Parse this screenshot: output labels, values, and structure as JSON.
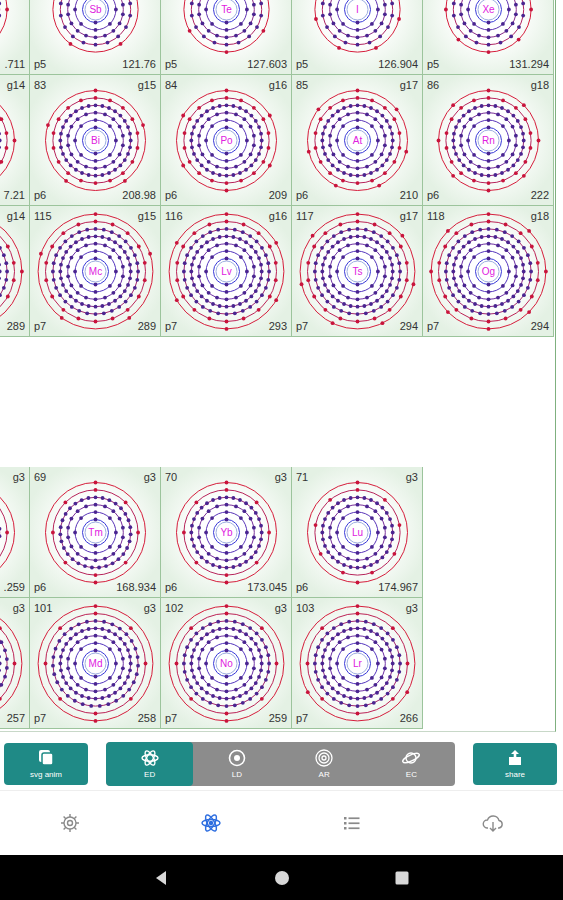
{
  "table": {
    "rows": [
      {
        "cells": [
          {
            "kind": "corner",
            "mass": ".711",
            "shells": [
              2,
              8,
              18,
              18,
              4
            ]
          },
          {
            "kind": "top",
            "symbol": "Sb",
            "period": "p5",
            "mass": "121.76",
            "shells": [
              2,
              8,
              18,
              18,
              5
            ]
          },
          {
            "kind": "top",
            "symbol": "Te",
            "period": "p5",
            "mass": "127.603",
            "shells": [
              2,
              8,
              18,
              18,
              6
            ]
          },
          {
            "kind": "top",
            "symbol": "I",
            "period": "p5",
            "mass": "126.904",
            "shells": [
              2,
              8,
              18,
              18,
              7
            ]
          },
          {
            "kind": "top",
            "symbol": "Xe",
            "period": "p5",
            "mass": "131.294",
            "shells": [
              2,
              8,
              18,
              18,
              8
            ]
          }
        ]
      },
      {
        "cells": [
          {
            "kind": "left",
            "group": "g14",
            "mass": "7.21",
            "shells": [
              2,
              8,
              18,
              32,
              18,
              4
            ]
          },
          {
            "kind": "full",
            "number": "83",
            "group": "g15",
            "symbol": "Bi",
            "period": "p6",
            "mass": "208.98",
            "shells": [
              2,
              8,
              18,
              32,
              18,
              5
            ]
          },
          {
            "kind": "full",
            "number": "84",
            "group": "g16",
            "symbol": "Po",
            "period": "p6",
            "mass": "209",
            "shells": [
              2,
              8,
              18,
              32,
              18,
              6
            ]
          },
          {
            "kind": "full",
            "number": "85",
            "group": "g17",
            "symbol": "At",
            "period": "p6",
            "mass": "210",
            "shells": [
              2,
              8,
              18,
              32,
              18,
              7
            ]
          },
          {
            "kind": "full",
            "number": "86",
            "group": "g18",
            "symbol": "Rn",
            "period": "p6",
            "mass": "222",
            "shells": [
              2,
              8,
              18,
              32,
              18,
              8
            ]
          }
        ]
      },
      {
        "cells": [
          {
            "kind": "left",
            "group": "g14",
            "mass": "289",
            "shells": [
              2,
              8,
              18,
              32,
              32,
              18,
              4
            ]
          },
          {
            "kind": "full",
            "number": "115",
            "group": "g15",
            "symbol": "Mc",
            "period": "p7",
            "mass": "289",
            "shells": [
              2,
              8,
              18,
              32,
              32,
              18,
              5
            ]
          },
          {
            "kind": "full",
            "number": "116",
            "group": "g16",
            "symbol": "Lv",
            "period": "p7",
            "mass": "293",
            "shells": [
              2,
              8,
              18,
              32,
              32,
              18,
              6
            ]
          },
          {
            "kind": "full",
            "number": "117",
            "group": "g17",
            "symbol": "Ts",
            "period": "p7",
            "mass": "294",
            "shells": [
              2,
              8,
              18,
              32,
              32,
              18,
              7
            ]
          },
          {
            "kind": "full",
            "number": "118",
            "group": "g18",
            "symbol": "Og",
            "period": "p7",
            "mass": "294",
            "shells": [
              2,
              8,
              18,
              32,
              32,
              18,
              8
            ]
          }
        ]
      }
    ]
  },
  "f_block": {
    "rows": [
      {
        "cells": [
          {
            "kind": "left",
            "group": "g3",
            "mass": ".259",
            "shells": [
              2,
              8,
              18,
              30,
              8,
              2
            ]
          },
          {
            "kind": "full",
            "number": "69",
            "group": "g3",
            "symbol": "Tm",
            "period": "p6",
            "mass": "168.934",
            "shells": [
              2,
              8,
              18,
              31,
              8,
              2
            ]
          },
          {
            "kind": "full",
            "number": "70",
            "group": "g3",
            "symbol": "Yb",
            "period": "p6",
            "mass": "173.045",
            "shells": [
              2,
              8,
              18,
              32,
              8,
              2
            ]
          },
          {
            "kind": "full",
            "number": "71",
            "group": "g3",
            "symbol": "Lu",
            "period": "p6",
            "mass": "174.967",
            "shells": [
              2,
              8,
              18,
              32,
              9,
              2
            ]
          }
        ]
      },
      {
        "cells": [
          {
            "kind": "left",
            "group": "g3",
            "mass": "257",
            "shells": [
              2,
              8,
              18,
              32,
              30,
              8,
              2
            ]
          },
          {
            "kind": "full",
            "number": "101",
            "group": "g3",
            "symbol": "Md",
            "period": "p7",
            "mass": "258",
            "shells": [
              2,
              8,
              18,
              32,
              31,
              8,
              2
            ]
          },
          {
            "kind": "full",
            "number": "102",
            "group": "g3",
            "symbol": "No",
            "period": "p7",
            "mass": "259",
            "shells": [
              2,
              8,
              18,
              32,
              32,
              8,
              2
            ]
          },
          {
            "kind": "full",
            "number": "103",
            "group": "g3",
            "symbol": "Lr",
            "period": "p7",
            "mass": "266",
            "shells": [
              2,
              8,
              18,
              32,
              32,
              8,
              3
            ]
          }
        ]
      }
    ]
  },
  "toolbar": {
    "left_button": {
      "label": "svg anim"
    },
    "modes": [
      {
        "label": "ED",
        "kind": "atom",
        "selected": true
      },
      {
        "label": "LD",
        "kind": "dot",
        "selected": false
      },
      {
        "label": "AR",
        "kind": "rings",
        "selected": false
      },
      {
        "label": "EC",
        "kind": "planet",
        "selected": false
      }
    ],
    "right_button": {
      "label": "share"
    }
  },
  "bottom_nav": [
    {
      "kind": "gear",
      "selected": false
    },
    {
      "kind": "atom",
      "selected": true
    },
    {
      "kind": "list",
      "selected": false
    },
    {
      "kind": "cloud",
      "selected": false
    }
  ]
}
